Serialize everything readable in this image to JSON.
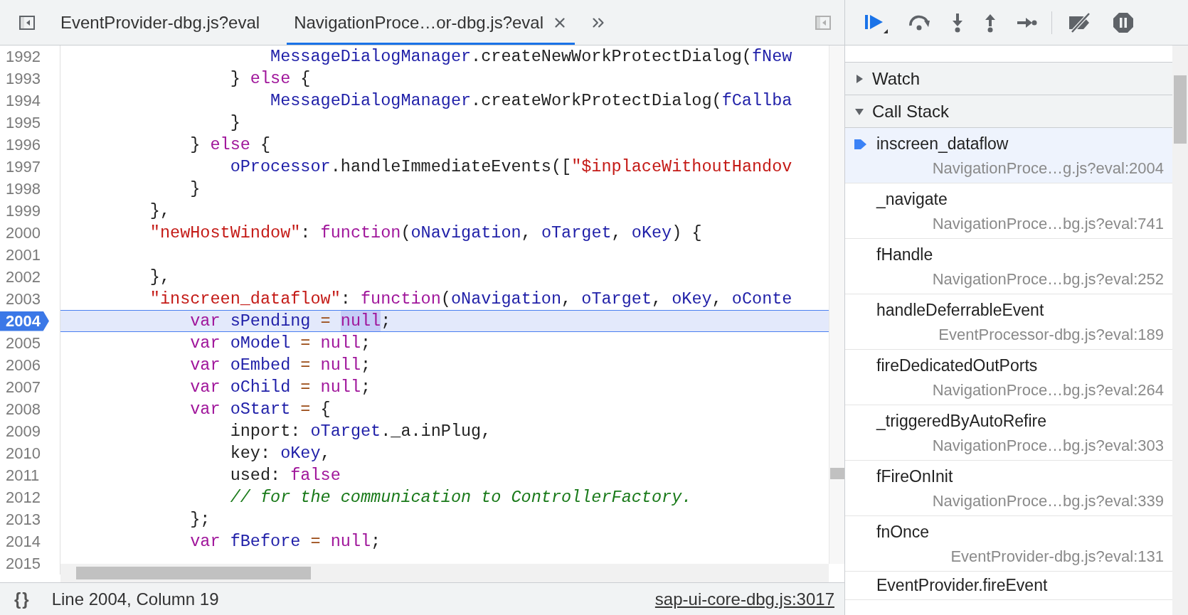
{
  "editor_tabs": [
    {
      "label": "EventProvider-dbg.js?eval",
      "selected": false
    },
    {
      "label": "NavigationProce…or-dbg.js?eval",
      "selected": true
    }
  ],
  "code": {
    "lines": [
      {
        "number": "1992",
        "current": false,
        "tokens": [
          {
            "kind": "variable",
            "text": "                    MessageDialogManager"
          },
          {
            "kind": "plain",
            "text": ".createNewWorkProtectDialog("
          },
          {
            "kind": "variable",
            "text": "fNew"
          }
        ]
      },
      {
        "number": "1993",
        "current": false,
        "tokens": [
          {
            "kind": "plain",
            "text": "                } "
          },
          {
            "kind": "keyword",
            "text": "else"
          },
          {
            "kind": "plain",
            "text": " {"
          }
        ]
      },
      {
        "number": "1994",
        "current": false,
        "tokens": [
          {
            "kind": "variable",
            "text": "                    MessageDialogManager"
          },
          {
            "kind": "plain",
            "text": ".createWorkProtectDialog("
          },
          {
            "kind": "variable",
            "text": "fCallba"
          }
        ]
      },
      {
        "number": "1995",
        "current": false,
        "tokens": [
          {
            "kind": "plain",
            "text": "                }"
          }
        ]
      },
      {
        "number": "1996",
        "current": false,
        "tokens": [
          {
            "kind": "plain",
            "text": "            } "
          },
          {
            "kind": "keyword",
            "text": "else"
          },
          {
            "kind": "plain",
            "text": " {"
          }
        ]
      },
      {
        "number": "1997",
        "current": false,
        "tokens": [
          {
            "kind": "variable",
            "text": "                oProcessor"
          },
          {
            "kind": "plain",
            "text": ".handleImmediateEvents(["
          },
          {
            "kind": "string",
            "text": "\"$inplaceWithoutHandov"
          }
        ]
      },
      {
        "number": "1998",
        "current": false,
        "tokens": [
          {
            "kind": "plain",
            "text": "            }"
          }
        ]
      },
      {
        "number": "1999",
        "current": false,
        "tokens": [
          {
            "kind": "plain",
            "text": "        },"
          }
        ]
      },
      {
        "number": "2000",
        "current": false,
        "tokens": [
          {
            "kind": "string",
            "text": "        \"newHostWindow\""
          },
          {
            "kind": "plain",
            "text": ": "
          },
          {
            "kind": "keyword",
            "text": "function"
          },
          {
            "kind": "plain",
            "text": "("
          },
          {
            "kind": "variable",
            "text": "oNavigation"
          },
          {
            "kind": "plain",
            "text": ", "
          },
          {
            "kind": "variable",
            "text": "oTarget"
          },
          {
            "kind": "plain",
            "text": ", "
          },
          {
            "kind": "variable",
            "text": "oKey"
          },
          {
            "kind": "plain",
            "text": ") {"
          }
        ]
      },
      {
        "number": "2001",
        "current": false
      },
      {
        "number": "2002",
        "current": false,
        "tokens": [
          {
            "kind": "plain",
            "text": "        },"
          }
        ]
      },
      {
        "number": "2003",
        "current": false,
        "tokens": [
          {
            "kind": "string",
            "text": "        \"inscreen_dataflow\""
          },
          {
            "kind": "plain",
            "text": ": "
          },
          {
            "kind": "keyword",
            "text": "function"
          },
          {
            "kind": "plain",
            "text": "("
          },
          {
            "kind": "variable",
            "text": "oNavigation"
          },
          {
            "kind": "plain",
            "text": ", "
          },
          {
            "kind": "variable",
            "text": "oTarget"
          },
          {
            "kind": "plain",
            "text": ", "
          },
          {
            "kind": "variable",
            "text": "oKey"
          },
          {
            "kind": "plain",
            "text": ", "
          },
          {
            "kind": "variable",
            "text": "oConte"
          }
        ]
      },
      {
        "number": "2004",
        "current": true,
        "tokens": [
          {
            "kind": "keyword",
            "text": "            var "
          },
          {
            "kind": "variable",
            "text": "sPending "
          },
          {
            "kind": "operator",
            "text": "= "
          },
          {
            "kind": "selection",
            "text": "null"
          },
          {
            "kind": "plain",
            "text": ";"
          }
        ]
      },
      {
        "number": "2005",
        "current": false,
        "tokens": [
          {
            "kind": "keyword",
            "text": "            var "
          },
          {
            "kind": "variable",
            "text": "oModel "
          },
          {
            "kind": "operator",
            "text": "= "
          },
          {
            "kind": "keyword",
            "text": "null"
          },
          {
            "kind": "plain",
            "text": ";"
          }
        ]
      },
      {
        "number": "2006",
        "current": false,
        "tokens": [
          {
            "kind": "keyword",
            "text": "            var "
          },
          {
            "kind": "variable",
            "text": "oEmbed "
          },
          {
            "kind": "operator",
            "text": "= "
          },
          {
            "kind": "keyword",
            "text": "null"
          },
          {
            "kind": "plain",
            "text": ";"
          }
        ]
      },
      {
        "number": "2007",
        "current": false,
        "tokens": [
          {
            "kind": "keyword",
            "text": "            var "
          },
          {
            "kind": "variable",
            "text": "oChild "
          },
          {
            "kind": "operator",
            "text": "= "
          },
          {
            "kind": "keyword",
            "text": "null"
          },
          {
            "kind": "plain",
            "text": ";"
          }
        ]
      },
      {
        "number": "2008",
        "current": false,
        "tokens": [
          {
            "kind": "keyword",
            "text": "            var "
          },
          {
            "kind": "variable",
            "text": "oStart "
          },
          {
            "kind": "operator",
            "text": "="
          },
          {
            "kind": "plain",
            "text": " {"
          }
        ]
      },
      {
        "number": "2009",
        "current": false,
        "tokens": [
          {
            "kind": "plain",
            "text": "                inport: "
          },
          {
            "kind": "variable",
            "text": "oTarget"
          },
          {
            "kind": "plain",
            "text": "._a.inPlug,"
          }
        ]
      },
      {
        "number": "2010",
        "current": false,
        "tokens": [
          {
            "kind": "plain",
            "text": "                key: "
          },
          {
            "kind": "variable",
            "text": "oKey"
          },
          {
            "kind": "plain",
            "text": ","
          }
        ]
      },
      {
        "number": "2011",
        "current": false,
        "tokens": [
          {
            "kind": "plain",
            "text": "                used: "
          },
          {
            "kind": "keyword",
            "text": "false"
          }
        ]
      },
      {
        "number": "2012",
        "current": false,
        "tokens": [
          {
            "kind": "comment",
            "text": "                // for the communication to ControllerFactory."
          }
        ]
      },
      {
        "number": "2013",
        "current": false,
        "tokens": [
          {
            "kind": "plain",
            "text": "            };"
          }
        ]
      },
      {
        "number": "2014",
        "current": false,
        "tokens": [
          {
            "kind": "keyword",
            "text": "            var "
          },
          {
            "kind": "variable",
            "text": "fBefore "
          },
          {
            "kind": "operator",
            "text": "= "
          },
          {
            "kind": "keyword",
            "text": "null"
          },
          {
            "kind": "plain",
            "text": ";"
          }
        ]
      },
      {
        "number": "2015",
        "current": false
      }
    ]
  },
  "status_bar": {
    "pretty_print": "{}",
    "position": "Line 2004, Column 19",
    "source_link": "sap-ui-core-dbg.js:3017"
  },
  "sections": [
    {
      "title": "Watch",
      "expanded": false
    },
    {
      "title": "Call Stack",
      "expanded": true,
      "frames": [
        {
          "name": "inscreen_dataflow",
          "location": "NavigationProce…g.js?eval:2004",
          "selected": true
        },
        {
          "name": "_navigate",
          "location": "NavigationProce…bg.js?eval:741",
          "selected": false
        },
        {
          "name": "fHandle",
          "location": "NavigationProce…bg.js?eval:252",
          "selected": false
        },
        {
          "name": "handleDeferrableEvent",
          "location": "EventProcessor-dbg.js?eval:189",
          "selected": false
        },
        {
          "name": "fireDedicatedOutPorts",
          "location": "NavigationProce…bg.js?eval:264",
          "selected": false
        },
        {
          "name": "_triggeredByAutoRefire",
          "location": "NavigationProce…bg.js?eval:303",
          "selected": false
        },
        {
          "name": "fFireOnInit",
          "location": "NavigationProce…bg.js?eval:339",
          "selected": false
        },
        {
          "name": "fnOnce",
          "location": "EventProvider-dbg.js?eval:131",
          "selected": false
        },
        {
          "name": "EventProvider.fireEvent",
          "selected": false
        }
      ]
    }
  ]
}
